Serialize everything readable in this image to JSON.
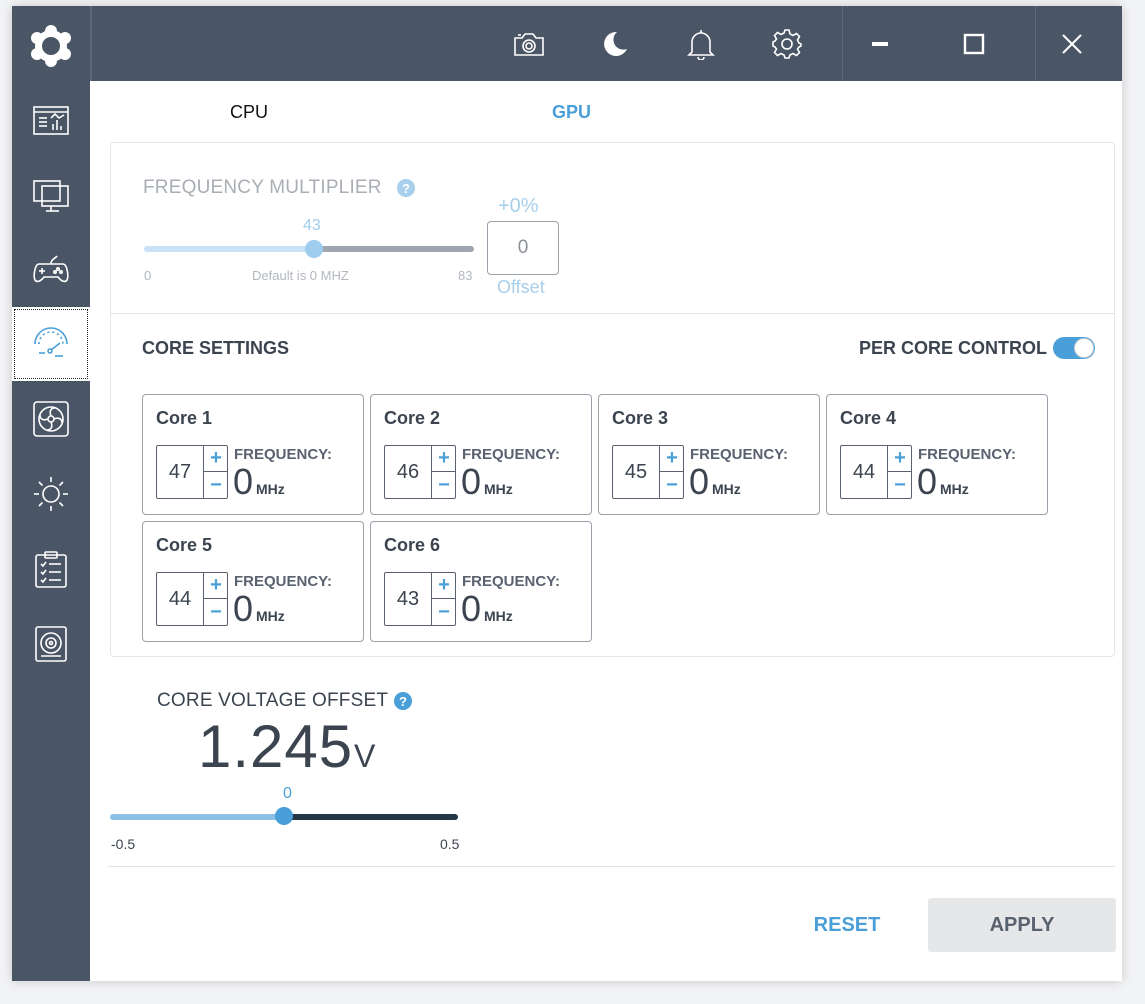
{
  "tabs": [
    {
      "label": "CPU"
    },
    {
      "label": "GPU"
    }
  ],
  "frequency": {
    "title": "FREQUENCY MULTIPLIER",
    "help": "?",
    "value": "43",
    "min": "0",
    "max": "83",
    "default_text": "Default is 0 MHZ",
    "offset_percent": "+0%",
    "offset_value": "0",
    "offset_label": "Offset"
  },
  "core_settings": {
    "title": "CORE SETTINGS",
    "per_core_label": "PER CORE CONTROL",
    "per_core_enabled": true,
    "freq_label": "FREQUENCY:",
    "unit": "MHz",
    "cores": [
      {
        "name": "Core 1",
        "value": "47",
        "frequency": "0"
      },
      {
        "name": "Core 2",
        "value": "46",
        "frequency": "0"
      },
      {
        "name": "Core 3",
        "value": "45",
        "frequency": "0"
      },
      {
        "name": "Core 4",
        "value": "44",
        "frequency": "0"
      },
      {
        "name": "Core 5",
        "value": "44",
        "frequency": "0"
      },
      {
        "name": "Core 6",
        "value": "43",
        "frequency": "0"
      }
    ]
  },
  "voltage": {
    "title": "CORE VOLTAGE OFFSET",
    "help": "?",
    "value": "1.245",
    "unit": "V",
    "slider_value": "0",
    "min": "-0.5",
    "max": "0.5"
  },
  "buttons": {
    "reset": "RESET",
    "apply": "APPLY"
  },
  "colors": {
    "sidebar": "#4a5565",
    "accent": "#4a9fd8"
  },
  "icons": {
    "topbar": [
      "camera-icon",
      "moon-icon",
      "bell-icon",
      "gear-icon",
      "minimize-icon",
      "maximize-icon",
      "close-icon"
    ],
    "sidebar": [
      "logo-icon",
      "dashboard-icon",
      "monitor-icon",
      "gamepad-icon",
      "speedometer-icon",
      "fan-icon",
      "brightness-icon",
      "checklist-icon",
      "speaker-icon"
    ]
  }
}
